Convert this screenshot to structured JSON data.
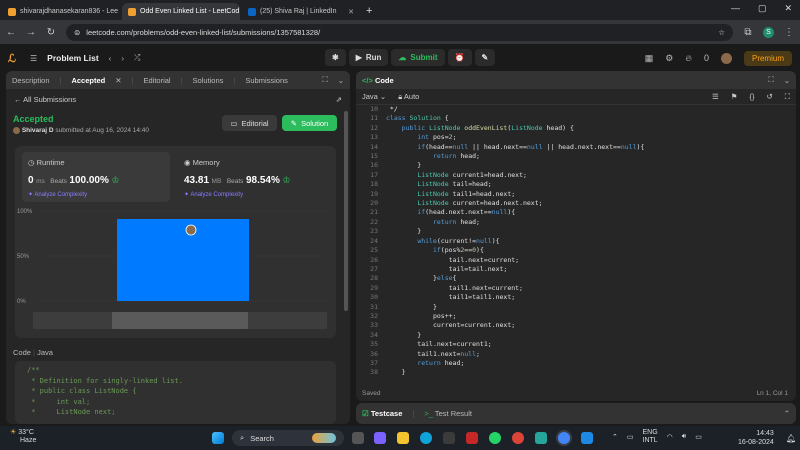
{
  "browser": {
    "tabs": [
      {
        "title": "shivarajdhanasekaran836 - Lee",
        "color": "#f0a030"
      },
      {
        "title": "Odd Even Linked List - LeetCod",
        "color": "#f0a030"
      },
      {
        "title": "(25) Shiva Raj | LinkedIn",
        "color": "#0a66c2"
      }
    ],
    "new_tab": "+",
    "url": "leetcode.com/problems/odd-even-linked-list/submissions/1357581328/",
    "profile_initial": "S"
  },
  "nav": {
    "problem_list": "Problem List",
    "run": "Run",
    "submit": "Submit",
    "coins": "0",
    "premium": "Premium"
  },
  "left_tabs": {
    "description": "Description",
    "accepted": "Accepted",
    "editorial": "Editorial",
    "solutions": "Solutions",
    "submissions": "Submissions"
  },
  "submission": {
    "back": "All Submissions",
    "status": "Accepted",
    "user": "Shivaraj D",
    "submitted": "submitted at Aug 16, 2024 14:40",
    "editorial_btn": "Editorial",
    "solution_btn": "Solution",
    "runtime_title": "Runtime",
    "runtime_value": "0",
    "runtime_unit": "ms",
    "runtime_beats_label": "Beats",
    "runtime_beats": "100.00%",
    "memory_title": "Memory",
    "memory_value": "43.81",
    "memory_unit": "MB",
    "memory_beats_label": "Beats",
    "memory_beats": "98.54%",
    "analyze": "Analyze Complexity",
    "code_label": "Code",
    "code_lang": "Java"
  },
  "chart_data": {
    "type": "bar",
    "yticks": [
      "100%",
      "50%",
      "0%"
    ],
    "ylim": [
      0,
      100
    ],
    "values": [
      100
    ],
    "bar_color": "#007bff"
  },
  "submitted_code": [
    "/**",
    " * Definition for singly-linked list.",
    " * public class ListNode {",
    " *     int val;",
    " *     ListNode next;"
  ],
  "editor": {
    "title": "Code",
    "language": "Java",
    "mode": "Auto",
    "status": "Saved",
    "cursor": "Ln 1, Col 1",
    "line_numbers": [
      "10",
      "11",
      "12",
      "13",
      "14",
      "15",
      "16",
      "17",
      "18",
      "19",
      "20",
      "21",
      "22",
      "23",
      "24",
      "25",
      "26",
      "27",
      "28",
      "29",
      "30",
      "31",
      "32",
      "33",
      "34",
      "35",
      "36",
      "37",
      "38"
    ],
    "lines": [
      " */",
      "class Solution {",
      "    public ListNode oddEvenList(ListNode head) {",
      "        int pos=2;",
      "        if(head==null || head.next==null || head.next.next==null){",
      "            return head;",
      "        }",
      "        ListNode current1=head.next;",
      "        ListNode tail=head;",
      "        ListNode tail1=head.next;",
      "        ListNode current=head.next.next;",
      "        if(head.next.next==null){",
      "            return head;",
      "        }",
      "        while(current!=null){",
      "            if(pos%2==0){",
      "                tail.next=current;",
      "                tail=tail.next;",
      "            }else{",
      "                tail1.next=current;",
      "                tail1=tail1.next;",
      "            }",
      "            pos++;",
      "            current=current.next;",
      "        }",
      "        tail.next=current1;",
      "        tail1.next=null;",
      "        return head;",
      "    }"
    ]
  },
  "bottom_tabs": {
    "testcase": "Testcase",
    "result": "Test Result"
  },
  "taskbar": {
    "temp": "33°C",
    "weather": "Haze",
    "search": "Search",
    "lang1": "ENG",
    "lang2": "INTL",
    "time": "14:43",
    "date": "16-08-2024"
  }
}
